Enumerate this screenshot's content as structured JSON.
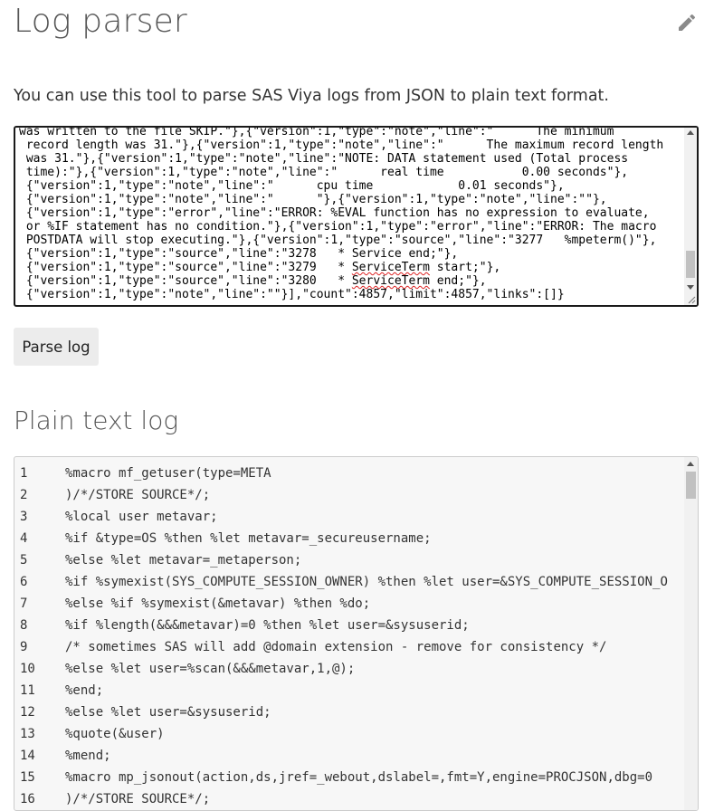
{
  "header": {
    "title": "Log parser",
    "edit_icon": "pencil-icon"
  },
  "intro_text": "You can use this tool to parse SAS Viya logs from JSON to plain text format.",
  "json_input": {
    "lines": [
      [
        "was written to the file SKIP.\"},{\"version\":1,\"type\":\"note\",\"line\":\"      The minimum"
      ],
      [
        " record length was 31.\"},{\"version\":1,\"type\":\"note\",\"line\":\"      The maximum record length"
      ],
      [
        " was 31.\"},{\"version\":1,\"type\":\"note\",\"line\":\"NOTE: DATA statement used (Total process"
      ],
      [
        " time):\"},{\"version\":1,\"type\":\"note\",\"line\":\"      real time           0.00 seconds\"},"
      ],
      [
        " {\"version\":1,\"type\":\"note\",\"line\":\"      cpu time            0.01 seconds\"},"
      ],
      [
        " {\"version\":1,\"type\":\"note\",\"line\":\"      \"},{\"version\":1,\"type\":\"note\",\"line\":\"\"},"
      ],
      [
        " {\"version\":1,\"type\":\"error\",\"line\":\"ERROR: %EVAL function has no expression to evaluate,"
      ],
      [
        " or %IF statement has no condition.\"},{\"version\":1,\"type\":\"error\",\"line\":\"ERROR: The macro"
      ],
      [
        " POSTDATA will stop executing.\"},{\"version\":1,\"type\":\"source\",\"line\":\"3277   %mpeterm()\"},"
      ],
      [
        " {\"version\":1,\"type\":\"source\",\"line\":\"3278   * Service end;\"},"
      ],
      [
        " {\"version\":1,\"type\":\"source\",\"line\":\"3279   * ",
        "ServiceTerm",
        " start;\"},"
      ],
      [
        " {\"version\":1,\"type\":\"source\",\"line\":\"3280   * ",
        "ServiceTerm",
        " end;\"},"
      ],
      [
        " {\"version\":1,\"type\":\"note\",\"line\":\"\"}],\"count\":4857,\"limit\":4857,\"links\":[]}"
      ]
    ]
  },
  "parse_button_label": "Parse log",
  "output": {
    "title": "Plain text log",
    "lines": [
      {
        "n": "1",
        "code": "%macro mf_getuser(type=META"
      },
      {
        "n": "2",
        "code": ")/*/STORE SOURCE*/;"
      },
      {
        "n": "3",
        "code": "%local user metavar;"
      },
      {
        "n": "4",
        "code": "%if &type=OS %then %let metavar=_secureusername;"
      },
      {
        "n": "5",
        "code": "%else %let metavar=_metaperson;"
      },
      {
        "n": "6",
        "code": "%if %symexist(SYS_COMPUTE_SESSION_OWNER) %then %let user=&SYS_COMPUTE_SESSION_O"
      },
      {
        "n": "7",
        "code": "%else %if %symexist(&metavar) %then %do;"
      },
      {
        "n": "8",
        "code": "%if %length(&&&metavar)=0 %then %let user=&sysuserid;"
      },
      {
        "n": "9",
        "code": "/* sometimes SAS will add @domain extension - remove for consistency */"
      },
      {
        "n": "10",
        "code": "%else %let user=%scan(&&&metavar,1,@);"
      },
      {
        "n": "11",
        "code": "%end;"
      },
      {
        "n": "12",
        "code": "%else %let user=&sysuserid;"
      },
      {
        "n": "13",
        "code": "%quote(&user)"
      },
      {
        "n": "14",
        "code": "%mend;"
      },
      {
        "n": "15",
        "code": "%macro mp_jsonout(action,ds,jref=_webout,dslabel=,fmt=Y,engine=PROCJSON,dbg=0"
      },
      {
        "n": "16",
        "code": ")/*/STORE SOURCE*/;"
      }
    ]
  }
}
